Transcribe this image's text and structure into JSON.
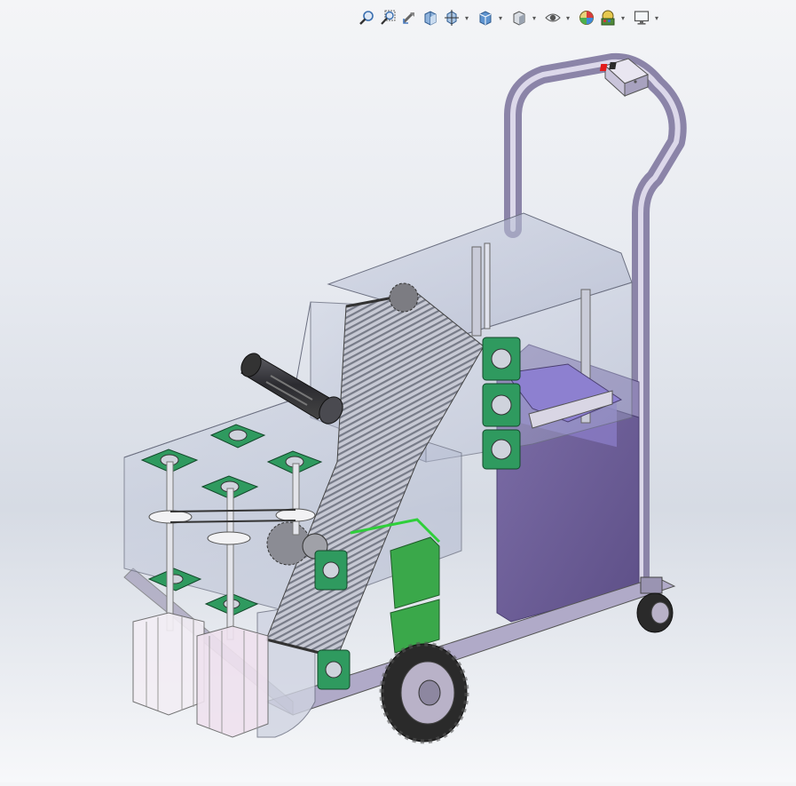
{
  "app": {
    "title": ""
  },
  "toolbar": {
    "buttons": [
      {
        "icon": "zoom-to-fit-icon"
      },
      {
        "icon": "zoom-to-area-icon"
      },
      {
        "icon": "previous-view-icon"
      },
      {
        "icon": "section-view-icon"
      },
      {
        "icon": "dynamic-annotation-view-icon",
        "has_dropdown": true
      },
      {
        "icon": "view-orientation-icon",
        "has_dropdown": true
      },
      {
        "icon": "display-style-icon",
        "has_dropdown": true
      },
      {
        "icon": "hide-show-items-icon",
        "has_dropdown": true
      },
      {
        "icon": "edit-appearance-icon"
      },
      {
        "icon": "apply-scene-icon",
        "has_dropdown": true
      },
      {
        "icon": "view-settings-icon",
        "has_dropdown": true
      }
    ]
  },
  "model": {
    "description_icon": "cart-assembly-model",
    "colors": {
      "frame": "#8b84a8",
      "enclosure_glass": "#b9bfd4",
      "bearing_green": "#2f9a5f",
      "motor_dark": "#3a3a3e",
      "box_purple": "#6f5f9a",
      "tire": "#2a2a2a",
      "rim": "#b9b2c8",
      "indicator_red": "#e21b1b"
    }
  }
}
